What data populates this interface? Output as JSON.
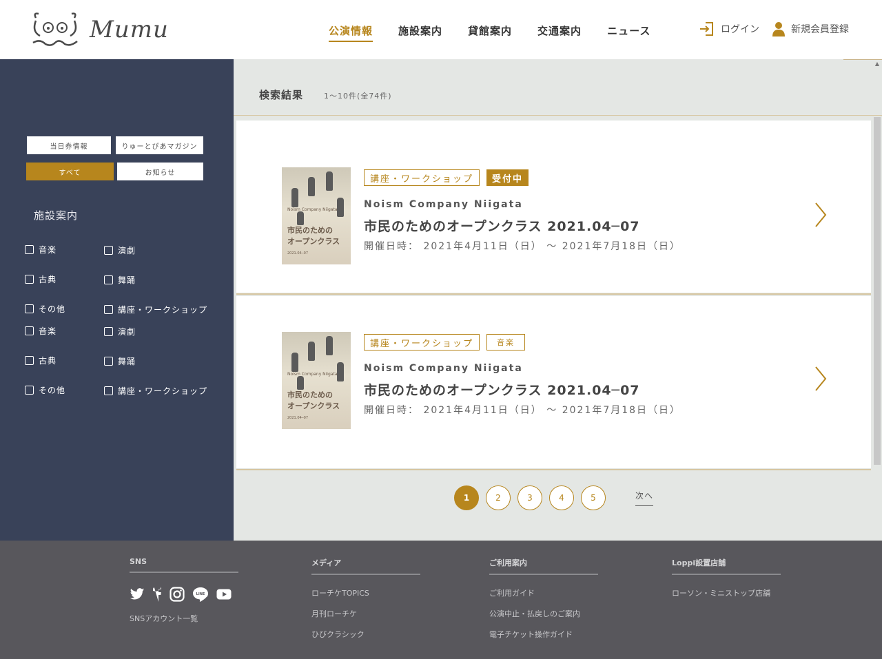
{
  "header": {
    "logo_text": "Mumu",
    "nav": [
      "公演情報",
      "施設案内",
      "貸館案内",
      "交通案内",
      "ニュース"
    ],
    "login": "ログイン",
    "register": "新規会員登録"
  },
  "sidebar": {
    "buttons": {
      "today_ticket": "当日券情報",
      "magazine": "りゅーとぴあマガジン",
      "all": "すべて",
      "notice": "お知らせ"
    },
    "heading": "施設案内",
    "checkboxes": [
      "音楽",
      "演劇",
      "古典",
      "舞踊",
      "その他",
      "講座・ワークショップ",
      "音楽",
      "演劇",
      "古典",
      "舞踊",
      "その他",
      "講座・ワークショップ"
    ]
  },
  "results": {
    "title": "検索結果",
    "count": "1〜10件(全74件)"
  },
  "events": [
    {
      "tags": [
        "講座・ワークショップ",
        "受付中"
      ],
      "company": "Noism Company Niigata",
      "title": "市民のためのオープンクラス 2021.04─07",
      "date": "開催日時： 2021年4月11日（日） 〜 2021年7月18日（日）",
      "thumb_company": "Noism Company Niigata",
      "thumb_title": "市民のための\nオープンクラス",
      "thumb_date": "2021.04─07"
    },
    {
      "tags": [
        "講座・ワークショップ",
        "音楽"
      ],
      "company": "Noism Company Niigata",
      "title": "市民のためのオープンクラス 2021.04─07",
      "date": "開催日時： 2021年4月11日（日） 〜 2021年7月18日（日）",
      "thumb_company": "Noism Company Niigata",
      "thumb_title": "市民のための\nオープンクラス",
      "thumb_date": "2021.04─07"
    }
  ],
  "pagination": {
    "pages": [
      "1",
      "2",
      "3",
      "4",
      "5"
    ],
    "current": "1",
    "next": "次へ"
  },
  "footer": {
    "sns": {
      "heading": "SNS",
      "icons": [
        "twitter-icon",
        "facebook-icon",
        "instagram-icon",
        "line-icon",
        "youtube-icon"
      ],
      "link": "SNSアカウント一覧"
    },
    "media": {
      "heading": "メディア",
      "links": [
        "ローチケTOPICS",
        "月刊ローチケ",
        "ひびクラシック"
      ]
    },
    "guide": {
      "heading": "ご利用案内",
      "links": [
        "ご利用ガイド",
        "公演中止・払戻しのご案内",
        "電子チケット操作ガイド"
      ]
    },
    "loppi": {
      "heading": "Loppi設置店舗",
      "links": [
        "ローソン・ミニストップ店舗"
      ]
    }
  },
  "colors": {
    "accent": "#b7861d",
    "sidebar": "#394259",
    "main_bg": "#e4e7e4",
    "footer": "#58575c"
  }
}
